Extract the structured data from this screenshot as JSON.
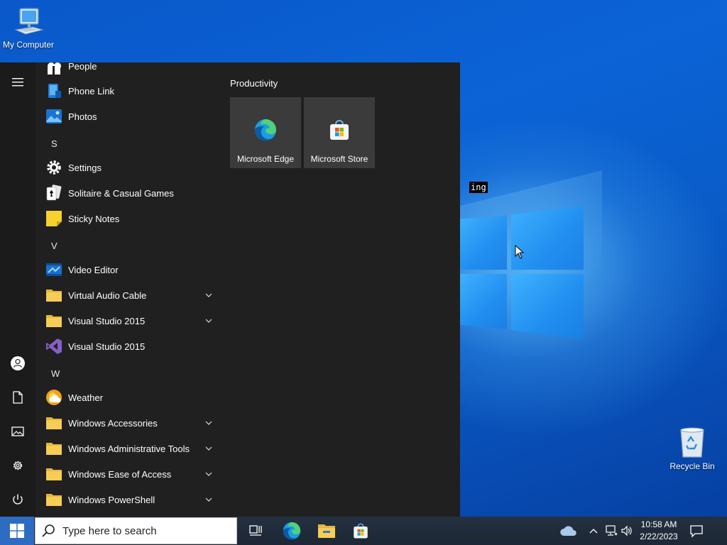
{
  "desktop": {
    "icons": [
      {
        "label": "My Computer",
        "icon": "computer-icon"
      },
      {
        "label": "Recycle Bin",
        "icon": "recycle-bin-icon"
      }
    ],
    "overlay_text": "ing"
  },
  "start_menu": {
    "rail": [
      "hamburger-menu-icon",
      "user-account-icon",
      "documents-icon",
      "pictures-icon",
      "settings-gear-icon",
      "power-icon"
    ],
    "apps": [
      {
        "type": "app",
        "label": "People",
        "icon": "people-icon"
      },
      {
        "type": "app",
        "label": "Phone Link",
        "icon": "phone-link-icon"
      },
      {
        "type": "app",
        "label": "Photos",
        "icon": "photos-icon"
      },
      {
        "type": "letter",
        "label": "S"
      },
      {
        "type": "app",
        "label": "Settings",
        "icon": "settings-icon"
      },
      {
        "type": "app",
        "label": "Solitaire & Casual Games",
        "icon": "solitaire-icon"
      },
      {
        "type": "app",
        "label": "Sticky Notes",
        "icon": "sticky-notes-icon"
      },
      {
        "type": "letter",
        "label": "V"
      },
      {
        "type": "app",
        "label": "Video Editor",
        "icon": "video-editor-icon"
      },
      {
        "type": "folder",
        "label": "Virtual Audio Cable",
        "icon": "folder-icon"
      },
      {
        "type": "folder",
        "label": "Visual Studio 2015",
        "icon": "folder-icon"
      },
      {
        "type": "app",
        "label": "Visual Studio 2015",
        "icon": "visual-studio-icon"
      },
      {
        "type": "letter",
        "label": "W"
      },
      {
        "type": "app",
        "label": "Weather",
        "icon": "weather-icon"
      },
      {
        "type": "folder",
        "label": "Windows Accessories",
        "icon": "folder-icon"
      },
      {
        "type": "folder",
        "label": "Windows Administrative Tools",
        "icon": "folder-icon"
      },
      {
        "type": "folder",
        "label": "Windows Ease of Access",
        "icon": "folder-icon"
      },
      {
        "type": "folder",
        "label": "Windows PowerShell",
        "icon": "folder-icon"
      }
    ],
    "tiles_group_title": "Productivity",
    "tiles": [
      {
        "label": "Microsoft Edge",
        "icon": "edge-icon"
      },
      {
        "label": "Microsoft Store",
        "icon": "store-icon"
      }
    ]
  },
  "taskbar": {
    "search_placeholder": "Type here to search",
    "pinned": [
      "task-view-icon",
      "edge-icon",
      "file-explorer-icon",
      "store-icon"
    ],
    "tray": [
      "onedrive-cloud-icon",
      "chevron-up-icon",
      "network-icon",
      "volume-icon"
    ],
    "time": "10:58 AM",
    "date": "2/22/2023",
    "notification_icon": "action-center-icon"
  }
}
